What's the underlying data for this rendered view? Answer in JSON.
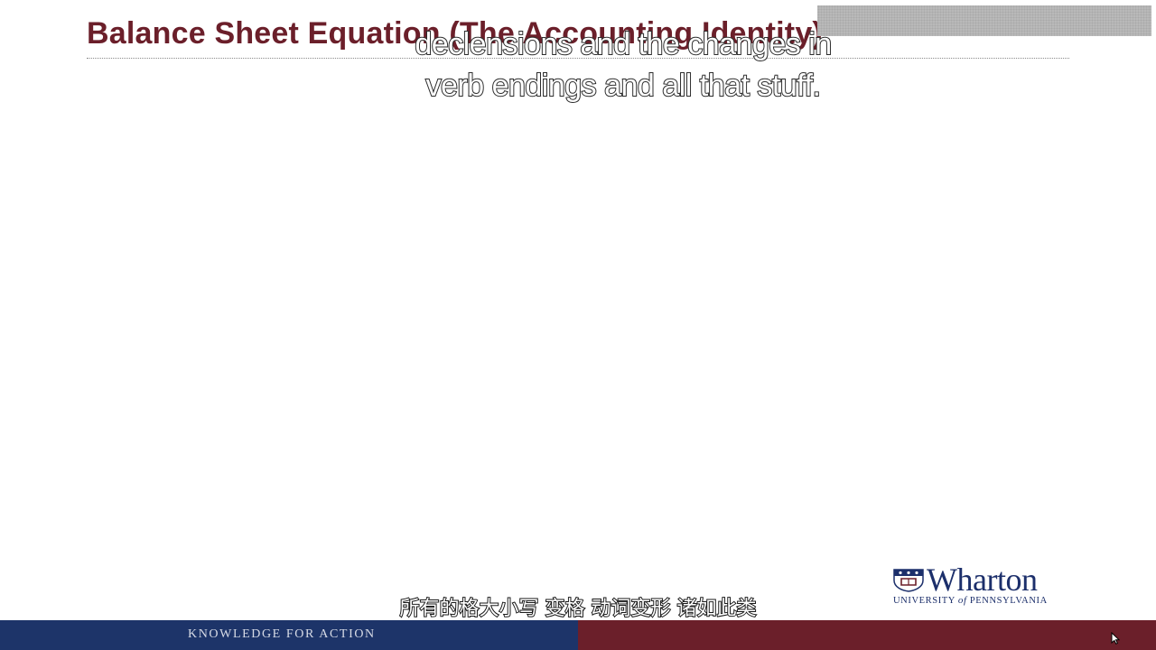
{
  "slide": {
    "title": "Balance Sheet Equation (The Accounting Identity)",
    "caption_en": {
      "line1": "declensions and the changes in",
      "line2": "verb endings and all that stuff."
    },
    "caption_zh": "所有的格大小写  变格  动词变形  诸如此类"
  },
  "logo": {
    "name": "Wharton",
    "university_prefix": "UNIVERSITY ",
    "university_of": "of",
    "university_suffix": " PENNSYLVANIA"
  },
  "footer": {
    "tagline": "KNOWLEDGE FOR ACTION"
  },
  "colors": {
    "title": "#6b1f2a",
    "footer_blue": "#1d3469",
    "footer_red": "#6b1f2a",
    "logo_blue": "#1c2f6b"
  }
}
